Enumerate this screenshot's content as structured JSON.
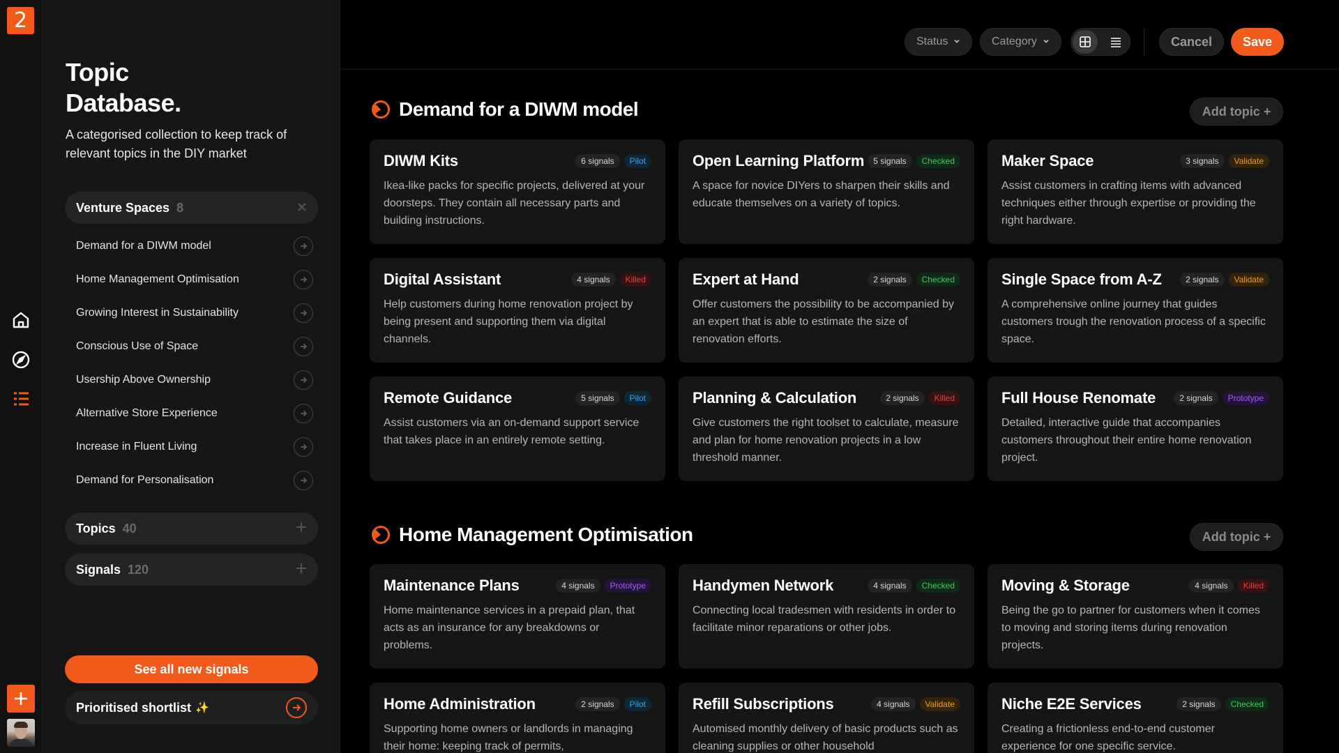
{
  "app": {
    "logo_glyph": "2",
    "accent": "#f25a1c"
  },
  "rail": {
    "icons": [
      "home-icon",
      "compass-icon",
      "list-icon"
    ],
    "add_icon": "plus-icon"
  },
  "sidebar": {
    "title": "Topic Database.",
    "description": "A categorised collection to keep track of relevant topics in the DIY market",
    "venture_spaces": {
      "label": "Venture Spaces",
      "count": "8",
      "items": [
        {
          "label": "Demand for a DIWM model"
        },
        {
          "label": "Home Management Optimisation"
        },
        {
          "label": "Growing Interest in Sustainability"
        },
        {
          "label": "Conscious Use of Space"
        },
        {
          "label": "Usership Above Ownership"
        },
        {
          "label": "Alternative Store Experience"
        },
        {
          "label": "Increase in Fluent Living"
        },
        {
          "label": "Demand for Personalisation"
        }
      ]
    },
    "topics": {
      "label": "Topics",
      "count": "40"
    },
    "signals": {
      "label": "Signals",
      "count": "120"
    },
    "cta_label": "See all new signals",
    "shortlist_label": "Prioritised shortlist",
    "shortlist_emoji": "✨"
  },
  "toolbar": {
    "status_label": "Status",
    "category_label": "Category",
    "cancel_label": "Cancel",
    "save_label": "Save"
  },
  "sections": [
    {
      "title": "Demand for a DIWM model",
      "add_label": "Add topic +",
      "cards": [
        {
          "title": "DIWM Kits",
          "signals": "6 signals",
          "status": "Pilot",
          "status_key": "pilot",
          "description": "Ikea-like packs for specific projects, delivered at your doorsteps. They contain all necessary parts and building instructions."
        },
        {
          "title": "Open Learning Platform",
          "signals": "5 signals",
          "status": "Checked",
          "status_key": "checked",
          "description": "A space for novice DIYers to sharpen their skills and educate themselves on a variety of topics."
        },
        {
          "title": "Maker Space",
          "signals": "3 signals",
          "status": "Validate",
          "status_key": "validate",
          "description": "Assist customers in crafting items with advanced techniques either through expertise or providing the right hardware."
        },
        {
          "title": "Digital Assistant",
          "signals": "4 signals",
          "status": "Killed",
          "status_key": "killed",
          "description": "Help customers during home renovation project by being present and supporting them via digital channels."
        },
        {
          "title": "Expert at Hand",
          "signals": "2 signals",
          "status": "Checked",
          "status_key": "checked",
          "description": "Offer customers the possibility to be accompanied by an expert that is able to estimate the size of renovation efforts."
        },
        {
          "title": "Single Space from A-Z",
          "signals": "2 signals",
          "status": "Validate",
          "status_key": "validate",
          "description": "A comprehensive online journey that guides customers trough the renovation process of a specific space."
        },
        {
          "title": "Remote Guidance",
          "signals": "5 signals",
          "status": "Pilot",
          "status_key": "pilot",
          "description": "Assist customers via an on-demand support service that takes place in an entirely remote setting."
        },
        {
          "title": "Planning & Calculation",
          "signals": "2 signals",
          "status": "Killed",
          "status_key": "killed",
          "description": "Give customers the right toolset to calculate, measure and plan for home renovation projects in a low threshold manner."
        },
        {
          "title": "Full House Renomate",
          "signals": "2 signals",
          "status": "Prototype",
          "status_key": "prototype",
          "description": "Detailed, interactive guide that accompanies customers throughout their entire home renovation project."
        }
      ]
    },
    {
      "title": "Home Management Optimisation",
      "add_label": "Add topic +",
      "cards": [
        {
          "title": "Maintenance Plans",
          "signals": "4 signals",
          "status": "Prototype",
          "status_key": "prototype",
          "description": "Home maintenance services in a prepaid plan, that acts as an insurance for any breakdowns or problems."
        },
        {
          "title": "Handymen Network",
          "signals": "4 signals",
          "status": "Checked",
          "status_key": "checked",
          "description": "Connecting local tradesmen with residents in order to facilitate minor reparations or other jobs."
        },
        {
          "title": "Moving & Storage",
          "signals": "4 signals",
          "status": "Killed",
          "status_key": "killed",
          "description": "Being the go to partner for customers when it comes to moving and storing items during renovation projects."
        },
        {
          "title": "Home Administration",
          "signals": "2 signals",
          "status": "Pilot",
          "status_key": "pilot",
          "description": "Supporting home owners or landlords in managing their home: keeping track of permits,"
        },
        {
          "title": "Refill Subscriptions",
          "signals": "4 signals",
          "status": "Validate",
          "status_key": "validate",
          "description": "Automised monthly delivery of basic products such as cleaning supplies or other household"
        },
        {
          "title": "Niche E2E Services",
          "signals": "2 signals",
          "status": "Checked",
          "status_key": "checked",
          "description": "Creating a frictionless end-to-end customer experience for one specific service."
        }
      ]
    }
  ]
}
